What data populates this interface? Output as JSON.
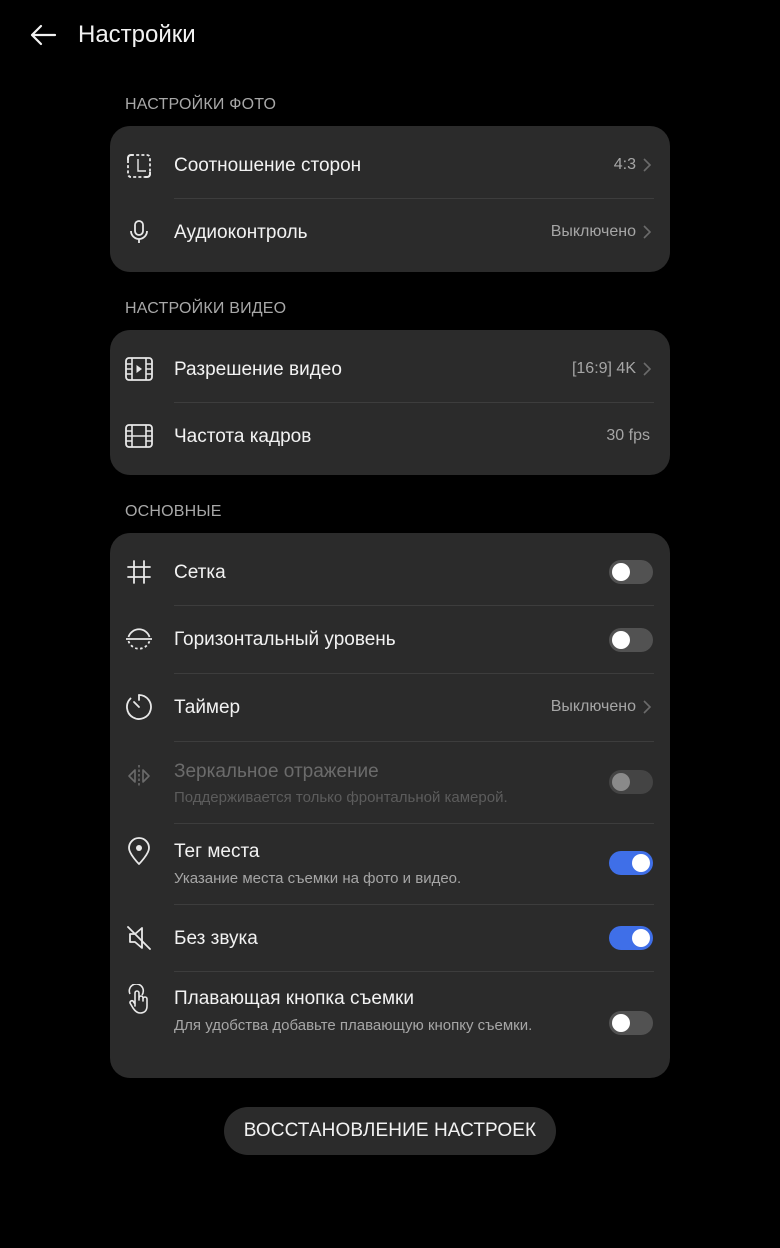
{
  "header": {
    "title": "Настройки"
  },
  "photo": {
    "section_title": "НАСТРОЙКИ ФОТО",
    "items": [
      {
        "label": "Соотношение сторон",
        "value": "4:3",
        "icon": "aspect-ratio-icon"
      },
      {
        "label": "Аудиоконтроль",
        "value": "Выключено",
        "icon": "microphone-icon"
      }
    ]
  },
  "video": {
    "section_title": "НАСТРОЙКИ ВИДЕО",
    "items": [
      {
        "label": "Разрешение видео",
        "value": "[16:9] 4K",
        "icon": "video-resolution-icon"
      },
      {
        "label": "Частота кадров",
        "value": "30 fps",
        "icon": "film-icon"
      }
    ]
  },
  "general": {
    "section_title": "ОСНОВНЫЕ",
    "items": [
      {
        "label": "Сетка",
        "icon": "grid-icon",
        "toggle": false
      },
      {
        "label": "Горизонтальный уровень",
        "icon": "level-icon",
        "toggle": false
      },
      {
        "label": "Таймер",
        "value": "Выключено",
        "icon": "timer-icon"
      },
      {
        "label": "Зеркальное отражение",
        "sub": "Поддерживается только фронтальной камерой.",
        "icon": "mirror-icon",
        "toggle": false,
        "disabled": true
      },
      {
        "label": "Тег места",
        "sub": "Указание места съемки на фото и видео.",
        "icon": "location-pin-icon",
        "toggle": true
      },
      {
        "label": "Без звука",
        "icon": "mute-icon",
        "toggle": true
      },
      {
        "label": "Плавающая кнопка съемки",
        "sub": "Для удобства добавьте плавающую кнопку съемки.",
        "icon": "touch-icon",
        "toggle": false
      }
    ]
  },
  "reset_button": "ВОССТАНОВЛЕНИЕ НАСТРОЕК",
  "colors": {
    "background": "#000000",
    "card": "#2b2b2b",
    "accent": "#3f6fe8"
  }
}
